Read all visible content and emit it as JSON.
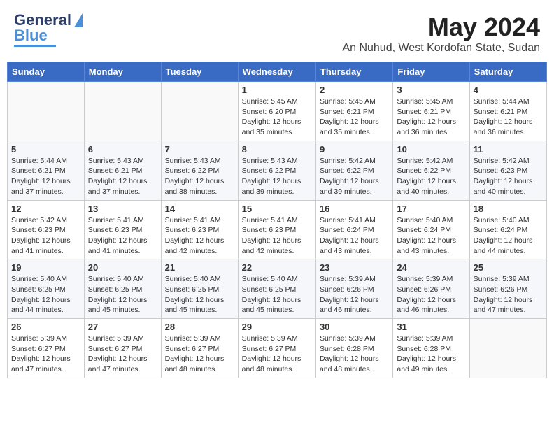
{
  "logo": {
    "text1": "General",
    "text2": "Blue"
  },
  "title": {
    "month_year": "May 2024",
    "location": "An Nuhud, West Kordofan State, Sudan"
  },
  "days_of_week": [
    "Sunday",
    "Monday",
    "Tuesday",
    "Wednesday",
    "Thursday",
    "Friday",
    "Saturday"
  ],
  "weeks": [
    [
      {
        "day": "",
        "info": ""
      },
      {
        "day": "",
        "info": ""
      },
      {
        "day": "",
        "info": ""
      },
      {
        "day": "1",
        "info": "Sunrise: 5:45 AM\nSunset: 6:20 PM\nDaylight: 12 hours and 35 minutes."
      },
      {
        "day": "2",
        "info": "Sunrise: 5:45 AM\nSunset: 6:21 PM\nDaylight: 12 hours and 35 minutes."
      },
      {
        "day": "3",
        "info": "Sunrise: 5:45 AM\nSunset: 6:21 PM\nDaylight: 12 hours and 36 minutes."
      },
      {
        "day": "4",
        "info": "Sunrise: 5:44 AM\nSunset: 6:21 PM\nDaylight: 12 hours and 36 minutes."
      }
    ],
    [
      {
        "day": "5",
        "info": "Sunrise: 5:44 AM\nSunset: 6:21 PM\nDaylight: 12 hours and 37 minutes."
      },
      {
        "day": "6",
        "info": "Sunrise: 5:43 AM\nSunset: 6:21 PM\nDaylight: 12 hours and 37 minutes."
      },
      {
        "day": "7",
        "info": "Sunrise: 5:43 AM\nSunset: 6:22 PM\nDaylight: 12 hours and 38 minutes."
      },
      {
        "day": "8",
        "info": "Sunrise: 5:43 AM\nSunset: 6:22 PM\nDaylight: 12 hours and 39 minutes."
      },
      {
        "day": "9",
        "info": "Sunrise: 5:42 AM\nSunset: 6:22 PM\nDaylight: 12 hours and 39 minutes."
      },
      {
        "day": "10",
        "info": "Sunrise: 5:42 AM\nSunset: 6:22 PM\nDaylight: 12 hours and 40 minutes."
      },
      {
        "day": "11",
        "info": "Sunrise: 5:42 AM\nSunset: 6:23 PM\nDaylight: 12 hours and 40 minutes."
      }
    ],
    [
      {
        "day": "12",
        "info": "Sunrise: 5:42 AM\nSunset: 6:23 PM\nDaylight: 12 hours and 41 minutes."
      },
      {
        "day": "13",
        "info": "Sunrise: 5:41 AM\nSunset: 6:23 PM\nDaylight: 12 hours and 41 minutes."
      },
      {
        "day": "14",
        "info": "Sunrise: 5:41 AM\nSunset: 6:23 PM\nDaylight: 12 hours and 42 minutes."
      },
      {
        "day": "15",
        "info": "Sunrise: 5:41 AM\nSunset: 6:23 PM\nDaylight: 12 hours and 42 minutes."
      },
      {
        "day": "16",
        "info": "Sunrise: 5:41 AM\nSunset: 6:24 PM\nDaylight: 12 hours and 43 minutes."
      },
      {
        "day": "17",
        "info": "Sunrise: 5:40 AM\nSunset: 6:24 PM\nDaylight: 12 hours and 43 minutes."
      },
      {
        "day": "18",
        "info": "Sunrise: 5:40 AM\nSunset: 6:24 PM\nDaylight: 12 hours and 44 minutes."
      }
    ],
    [
      {
        "day": "19",
        "info": "Sunrise: 5:40 AM\nSunset: 6:25 PM\nDaylight: 12 hours and 44 minutes."
      },
      {
        "day": "20",
        "info": "Sunrise: 5:40 AM\nSunset: 6:25 PM\nDaylight: 12 hours and 45 minutes."
      },
      {
        "day": "21",
        "info": "Sunrise: 5:40 AM\nSunset: 6:25 PM\nDaylight: 12 hours and 45 minutes."
      },
      {
        "day": "22",
        "info": "Sunrise: 5:40 AM\nSunset: 6:25 PM\nDaylight: 12 hours and 45 minutes."
      },
      {
        "day": "23",
        "info": "Sunrise: 5:39 AM\nSunset: 6:26 PM\nDaylight: 12 hours and 46 minutes."
      },
      {
        "day": "24",
        "info": "Sunrise: 5:39 AM\nSunset: 6:26 PM\nDaylight: 12 hours and 46 minutes."
      },
      {
        "day": "25",
        "info": "Sunrise: 5:39 AM\nSunset: 6:26 PM\nDaylight: 12 hours and 47 minutes."
      }
    ],
    [
      {
        "day": "26",
        "info": "Sunrise: 5:39 AM\nSunset: 6:27 PM\nDaylight: 12 hours and 47 minutes."
      },
      {
        "day": "27",
        "info": "Sunrise: 5:39 AM\nSunset: 6:27 PM\nDaylight: 12 hours and 47 minutes."
      },
      {
        "day": "28",
        "info": "Sunrise: 5:39 AM\nSunset: 6:27 PM\nDaylight: 12 hours and 48 minutes."
      },
      {
        "day": "29",
        "info": "Sunrise: 5:39 AM\nSunset: 6:27 PM\nDaylight: 12 hours and 48 minutes."
      },
      {
        "day": "30",
        "info": "Sunrise: 5:39 AM\nSunset: 6:28 PM\nDaylight: 12 hours and 48 minutes."
      },
      {
        "day": "31",
        "info": "Sunrise: 5:39 AM\nSunset: 6:28 PM\nDaylight: 12 hours and 49 minutes."
      },
      {
        "day": "",
        "info": ""
      }
    ]
  ]
}
